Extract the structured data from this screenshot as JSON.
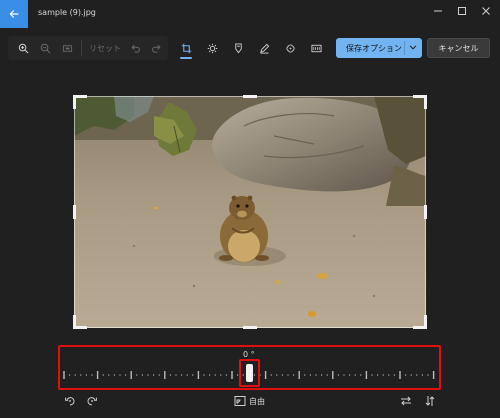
{
  "window": {
    "title": "sample (9).jpg",
    "accent_color": "#3a8ee6"
  },
  "toolbar": {
    "reset_label": "リセット",
    "save_label": "保存オプション",
    "cancel_label": "キャンセル",
    "save_color": "#71b4f0"
  },
  "icons": {
    "back": "back-arrow-icon",
    "minimize": "minimize-icon",
    "maximize": "maximize-icon",
    "close": "close-icon",
    "zoom_in": "zoom-in-icon",
    "zoom_out": "zoom-out-icon",
    "fit": "fit-to-window-icon",
    "undo": "undo-icon",
    "redo": "redo-icon",
    "crop": "crop-icon",
    "adjust": "brightness-adjust-icon",
    "filter": "filter-icon",
    "markup": "markup-pen-icon",
    "retouch": "retouch-icon",
    "background": "background-blur-icon",
    "rotate_left": "rotate-left-icon",
    "rotate_right": "rotate-right-icon",
    "aspect": "aspect-ratio-icon",
    "flip_h": "flip-horizontal-icon",
    "flip_v": "flip-vertical-icon"
  },
  "crop": {
    "angle": "0 °",
    "angle_value": 0,
    "aspect_label": "自由"
  },
  "highlight_color": "#e01010"
}
